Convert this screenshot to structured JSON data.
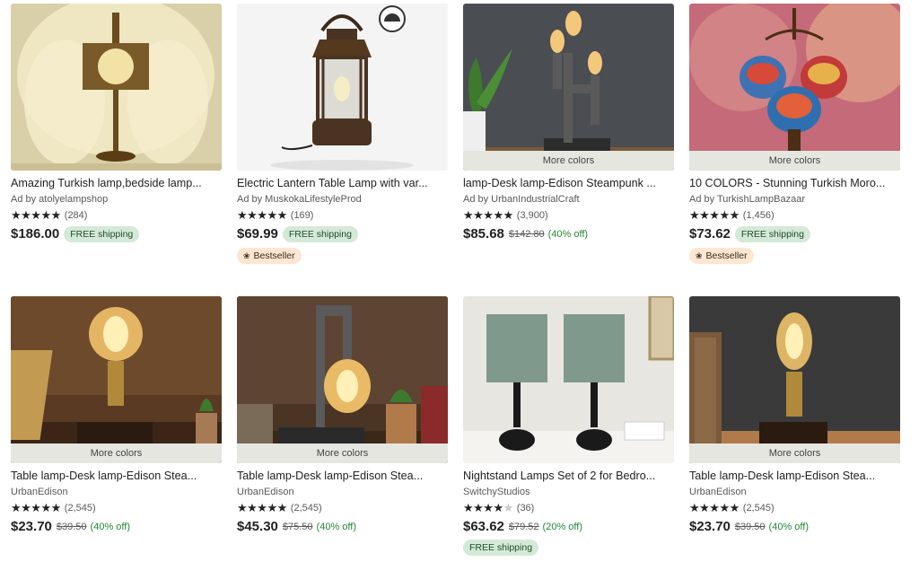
{
  "colors": {
    "shipping_bg": "#d4e9d7",
    "bestseller_bg": "#fde6d2",
    "discount": "#258635",
    "more_colors_bg": "#e6e6e1"
  },
  "products": [
    {
      "title": "Amazing Turkish lamp,bedside lamp...",
      "seller": "Ad by atolyelampshop",
      "stars": 5,
      "reviews": "(284)",
      "price": "$186.00",
      "shipping": "FREE shipping"
    },
    {
      "title": "Electric Lantern Table Lamp with var...",
      "seller": "Ad by MuskokaLifestyleProd",
      "stars": 5,
      "reviews": "(169)",
      "price": "$69.99",
      "shipping": "FREE shipping",
      "badge": "Bestseller",
      "thumb_badge_icon": "dimmable-icon"
    },
    {
      "title": "lamp-Desk lamp-Edison Steampunk ...",
      "seller": "Ad by UrbanIndustrialCraft",
      "stars": 5,
      "reviews": "(3,900)",
      "price": "$85.68",
      "original_price": "$142.80",
      "discount": "(40% off)",
      "more_colors": "More colors"
    },
    {
      "title": "10 COLORS - Stunning Turkish Moro...",
      "seller": "Ad by TurkishLampBazaar",
      "stars": 5,
      "reviews": "(1,456)",
      "price": "$73.62",
      "shipping": "FREE shipping",
      "badge": "Bestseller",
      "more_colors": "More colors"
    },
    {
      "title": "Table lamp-Desk lamp-Edison Stea...",
      "seller": "UrbanEdison",
      "stars": 5,
      "reviews": "(2,545)",
      "price": "$23.70",
      "original_price": "$39.50",
      "discount": "(40% off)",
      "more_colors": "More colors"
    },
    {
      "title": "Table lamp-Desk lamp-Edison Stea...",
      "seller": "UrbanEdison",
      "stars": 5,
      "reviews": "(2,545)",
      "price": "$45.30",
      "original_price": "$75.50",
      "discount": "(40% off)",
      "more_colors": "More colors"
    },
    {
      "title": "Nightstand Lamps Set of 2 for Bedro...",
      "seller": "SwitchyStudios",
      "stars": 4,
      "reviews": "(36)",
      "price": "$63.62",
      "original_price": "$79.52",
      "discount": "(20% off)",
      "shipping": "FREE shipping"
    },
    {
      "title": "Table lamp-Desk lamp-Edison Stea...",
      "seller": "UrbanEdison",
      "stars": 5,
      "reviews": "(2,545)",
      "price": "$23.70",
      "original_price": "$39.50",
      "discount": "(40% off)",
      "more_colors": "More colors"
    }
  ]
}
